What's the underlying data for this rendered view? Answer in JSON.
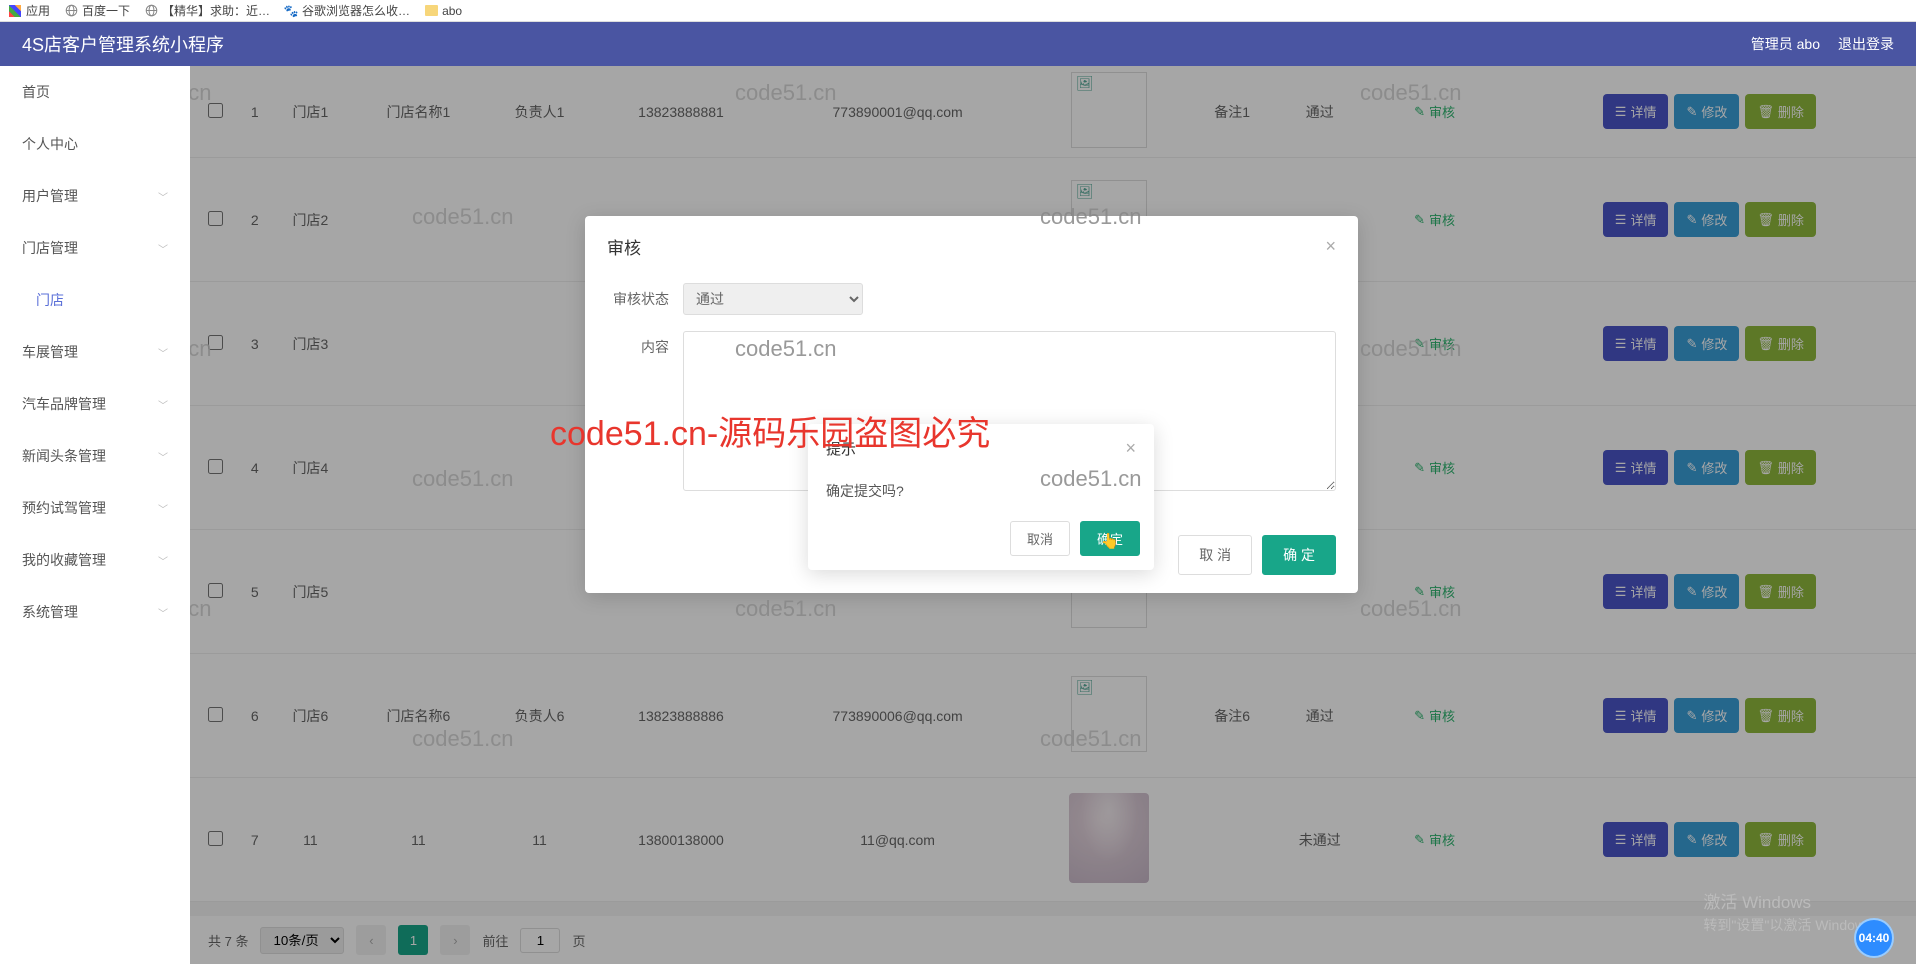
{
  "bookmarks": {
    "apps": "应用",
    "baidu": "百度一下",
    "jinghua": "【精华】求助：近…",
    "guge": "谷歌浏览器怎么收…",
    "abo": "abo"
  },
  "header": {
    "title": "4S店客户管理系统小程序",
    "admin": "管理员 abo",
    "logout": "退出登录"
  },
  "sidebar": {
    "items": [
      {
        "label": "首页"
      },
      {
        "label": "个人中心"
      },
      {
        "label": "用户管理"
      },
      {
        "label": "门店管理"
      },
      {
        "label": "门店",
        "sub": true
      },
      {
        "label": "车展管理"
      },
      {
        "label": "汽车品牌管理"
      },
      {
        "label": "新闻头条管理"
      },
      {
        "label": "预约试驾管理"
      },
      {
        "label": "我的收藏管理"
      },
      {
        "label": "系统管理"
      }
    ]
  },
  "table": {
    "rows": [
      {
        "idx": "1",
        "store": "门店1",
        "name": "门店名称1",
        "person": "负责人1",
        "phone": "13823888881",
        "email": "773890001@qq.com",
        "remark": "备注1",
        "status": "通过"
      },
      {
        "idx": "2",
        "store": "门店2",
        "name": "",
        "person": "",
        "phone": "",
        "email": "",
        "remark": "",
        "status": ""
      },
      {
        "idx": "3",
        "store": "门店3",
        "name": "",
        "person": "",
        "phone": "",
        "email": "",
        "remark": "",
        "status": ""
      },
      {
        "idx": "4",
        "store": "门店4",
        "name": "",
        "person": "",
        "phone": "",
        "email": "",
        "remark": "",
        "status": ""
      },
      {
        "idx": "5",
        "store": "门店5",
        "name": "",
        "person": "",
        "phone": "",
        "email": "",
        "remark": "",
        "status": ""
      },
      {
        "idx": "6",
        "store": "门店6",
        "name": "门店名称6",
        "person": "负责人6",
        "phone": "13823888886",
        "email": "773890006@qq.com",
        "remark": "备注6",
        "status": "通过"
      },
      {
        "idx": "7",
        "store": "11",
        "name": "11",
        "person": "11",
        "phone": "13800138000",
        "email": "11@qq.com",
        "remark": "",
        "status": "未通过"
      }
    ],
    "review_label": "审核",
    "detail_label": "详情",
    "edit_label": "修改",
    "delete_label": "删除"
  },
  "pager": {
    "total": "共 7 条",
    "per_page": "10条/页",
    "page": "1",
    "jump_prefix": "前往",
    "jump_val": "1",
    "jump_suffix": "页"
  },
  "audit_dialog": {
    "title": "审核",
    "status_label": "审核状态",
    "status_value": "通过",
    "content_label": "内容",
    "cancel": "取 消",
    "ok": "确 定"
  },
  "prompt_dialog": {
    "title": "提示",
    "msg": "确定提交吗?",
    "cancel": "取消",
    "ok": "确定"
  },
  "watermarks": {
    "wm": "code51.cn",
    "red": "code51.cn-源码乐园盗图必究"
  },
  "win": {
    "t": "激活 Windows",
    "s": "转到\"设置\"以激活 Windows。"
  },
  "clock": "04:40"
}
